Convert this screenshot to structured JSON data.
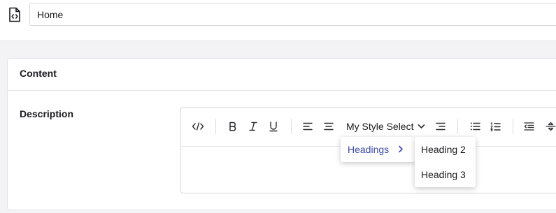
{
  "header": {
    "icon": "document-code-icon",
    "name_value": "Home"
  },
  "content_group": {
    "title": "Content",
    "property": {
      "label": "Description",
      "editor": {
        "toolbar": {
          "buttons": [
            {
              "name": "source-code-icon"
            },
            {
              "name": "bold-icon"
            },
            {
              "name": "italic-icon"
            },
            {
              "name": "underline-icon"
            },
            {
              "name": "align-left-icon"
            },
            {
              "name": "align-center-icon"
            },
            {
              "name": "align-right-icon"
            },
            {
              "name": "bullet-list-icon"
            },
            {
              "name": "numbered-list-icon"
            },
            {
              "name": "outdent-icon"
            },
            {
              "name": "strikethrough-icon"
            }
          ],
          "style_select_label": "My Style Select"
        },
        "dropdown": {
          "group_label": "Headings",
          "submenu_items": [
            "Heading 2",
            "Heading 3"
          ]
        }
      }
    }
  },
  "colors": {
    "accent": "#3b4ba8",
    "border": "#d6d6dc",
    "background": "#f3f3f5"
  }
}
